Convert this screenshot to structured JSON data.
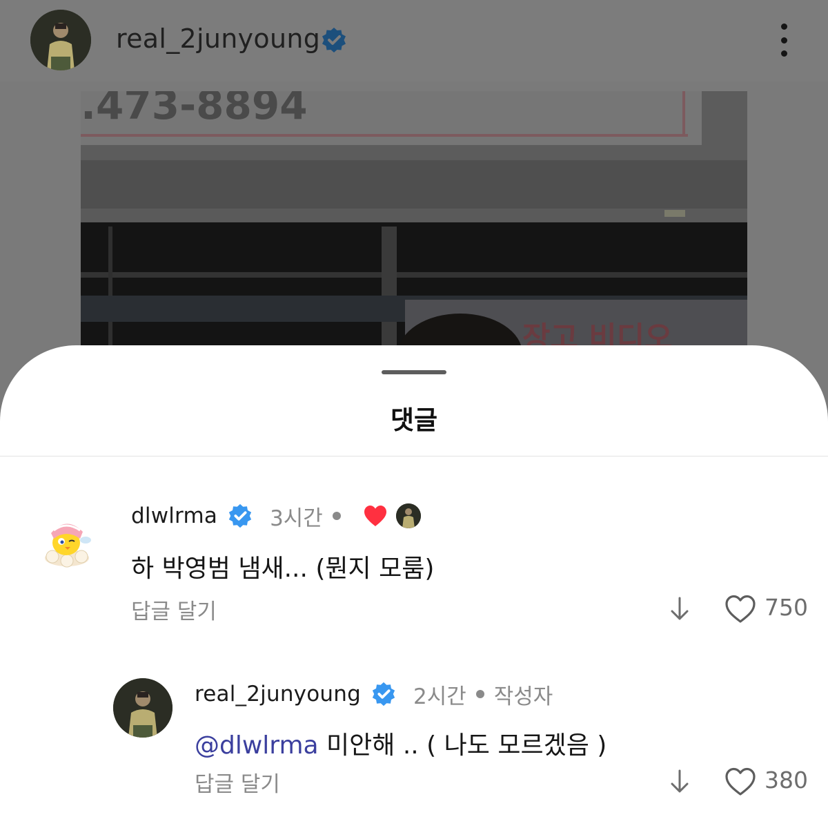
{
  "post": {
    "username": "real_2junyoung",
    "verified": true,
    "avatar": "person-photo-avatar",
    "more_icon": "more-vertical-icon",
    "photo_sign_text": ".473-8894",
    "photo_storefront_text": "장고 비디오"
  },
  "sheet": {
    "title": "댓글"
  },
  "comments": [
    {
      "username": "dlwlrma",
      "verified": true,
      "time": "3시간",
      "liked_by_author": true,
      "avatar": "cartoon-bird-avatar",
      "text": "하 박영범 냄새... (뭔지 모룸)",
      "reply_label": "답글 달기",
      "likes": "750"
    },
    {
      "username": "real_2junyoung",
      "verified": true,
      "time": "2시간",
      "author_tag": "작성자",
      "avatar": "person-photo-avatar",
      "mention": "@dlwlrma",
      "text": " 미안해 .. ( 나도 모르겠음 )",
      "reply_label": "답글 달기",
      "likes": "380"
    }
  ],
  "colors": {
    "verified_blue": "#3897f0",
    "heart_red": "#ff3040",
    "mention": "#3b3f9e"
  }
}
